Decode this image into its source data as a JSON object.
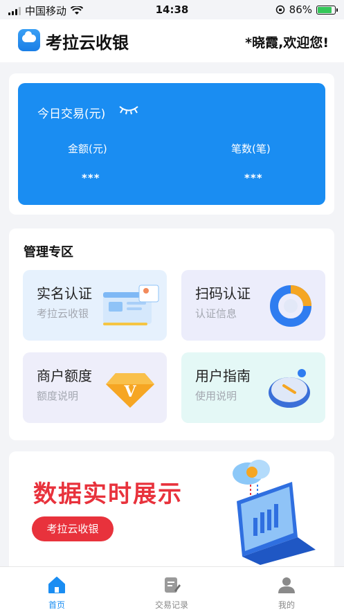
{
  "status_bar": {
    "carrier": "中国移动",
    "time": "14:38",
    "battery": "86%",
    "battery_level": 0.86
  },
  "header": {
    "app_name": "考拉云收银",
    "welcome": "*晓霞,欢迎您!"
  },
  "trade_summary": {
    "title": "今日交易(元)",
    "amount_label": "金额(元)",
    "amount_value": "***",
    "count_label": "笔数(笔)",
    "count_value": "***"
  },
  "management": {
    "title": "管理专区",
    "tiles": [
      {
        "title": "实名认证",
        "subtitle": "考拉云收银",
        "icon": "id-card-illustration",
        "bg": "#e6f1fd"
      },
      {
        "title": "扫码认证",
        "subtitle": "认证信息",
        "icon": "scan-ring-illustration",
        "bg": "#ecedfb"
      },
      {
        "title": "商户额度",
        "subtitle": "额度说明",
        "icon": "diamond-v-illustration",
        "bg": "#eeeefa"
      },
      {
        "title": "用户指南",
        "subtitle": "使用说明",
        "icon": "compass-dial-illustration",
        "bg": "#e4f8f6"
      }
    ]
  },
  "banner": {
    "headline": "数据实时展示",
    "button": "考拉云收银"
  },
  "tabbar": {
    "items": [
      {
        "label": "首页",
        "icon": "home-icon",
        "active": true
      },
      {
        "label": "交易记录",
        "icon": "records-icon",
        "active": false
      },
      {
        "label": "我的",
        "icon": "profile-icon",
        "active": false
      }
    ]
  },
  "colors": {
    "primary": "#1a8df2",
    "accent_red": "#e8323c"
  }
}
